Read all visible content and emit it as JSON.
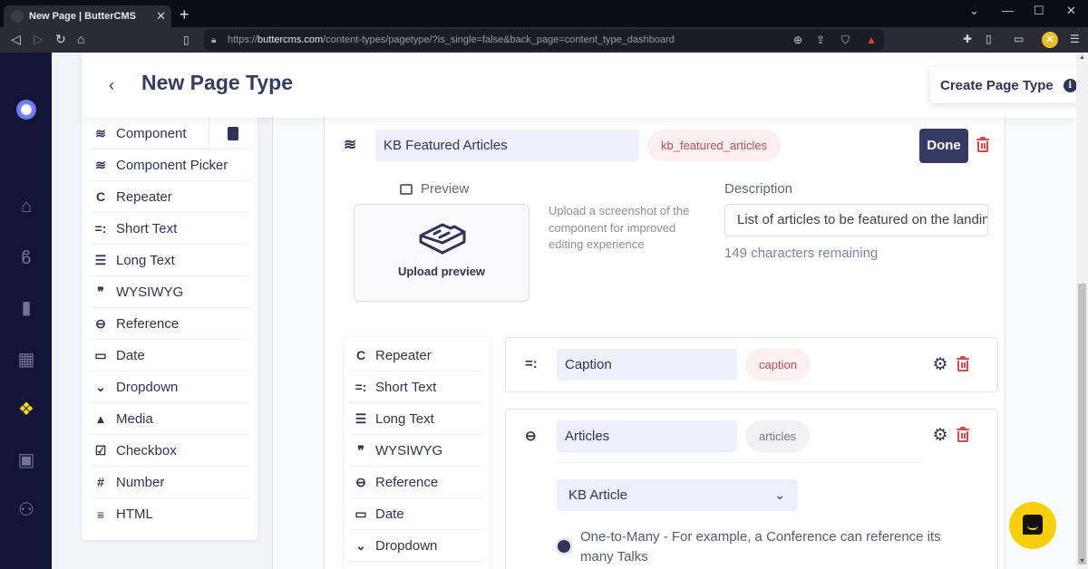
{
  "browser": {
    "tab_title": "New Page | ButterCMS",
    "tab_close": "✕",
    "new_tab": "+",
    "url_host": "buttercms.com",
    "url_scheme": "https://",
    "url_path": "/content-types/pagetype/?is_single=false&back_page=content_type_dashboard",
    "window_controls": [
      "⌄",
      "—",
      "☐",
      "✕"
    ],
    "nav_icons": [
      "back-icon",
      "forward-icon",
      "reload-icon",
      "home-icon"
    ],
    "profile_initial": "✕"
  },
  "app_nav": {
    "items": [
      {
        "icon": "home-icon",
        "glyph": "⌂"
      },
      {
        "icon": "blog-icon",
        "glyph": "ϐ"
      },
      {
        "icon": "page-icon",
        "glyph": "▮"
      },
      {
        "icon": "collections-icon",
        "glyph": "▦"
      },
      {
        "icon": "content-types-icon",
        "glyph": "❖",
        "active": true
      },
      {
        "icon": "media-icon",
        "glyph": "▣"
      },
      {
        "icon": "users-icon",
        "glyph": "⚇"
      }
    ]
  },
  "header": {
    "back_glyph": "‹",
    "title": "New Page Type",
    "create_button": "Create Page Type",
    "info_glyph": "i"
  },
  "palette": {
    "items": [
      {
        "label": "Component",
        "icon": "layers-icon",
        "glyph": "≋"
      },
      {
        "label": "Component Picker",
        "icon": "layers-plus-icon",
        "glyph": "≋"
      },
      {
        "label": "Repeater",
        "icon": "repeat-icon",
        "glyph": "C"
      },
      {
        "label": "Short Text",
        "icon": "short-text-icon",
        "glyph": "=:"
      },
      {
        "label": "Long Text",
        "icon": "long-text-icon",
        "glyph": "☰"
      },
      {
        "label": "WYSIWYG",
        "icon": "quote-icon",
        "glyph": "❞"
      },
      {
        "label": "Reference",
        "icon": "link-icon",
        "glyph": "⊖"
      },
      {
        "label": "Date",
        "icon": "calendar-icon",
        "glyph": "▭"
      },
      {
        "label": "Dropdown",
        "icon": "chevron-down-icon",
        "glyph": "⌄"
      },
      {
        "label": "Media",
        "icon": "image-icon",
        "glyph": "▴"
      },
      {
        "label": "Checkbox",
        "icon": "checkbox-icon",
        "glyph": "☑"
      },
      {
        "label": "Number",
        "icon": "hash-icon",
        "glyph": "#"
      },
      {
        "label": "HTML",
        "icon": "list-icon",
        "glyph": "≡"
      }
    ]
  },
  "component": {
    "name": "KB Featured Articles",
    "key": "kb_featured_articles",
    "done_button": "Done",
    "preview_label": "Preview",
    "upload_label": "Upload preview",
    "upload_hint": "Upload a screenshot of the component for improved editing experience",
    "description_label": "Description",
    "description_value": "List of articles to be featured on the landing page",
    "chars_remaining": "149 characters remaining"
  },
  "nested_palette": {
    "items": [
      {
        "label": "Repeater",
        "icon": "repeat-icon",
        "glyph": "C"
      },
      {
        "label": "Short Text",
        "icon": "short-text-icon",
        "glyph": "=:"
      },
      {
        "label": "Long Text",
        "icon": "long-text-icon",
        "glyph": "☰"
      },
      {
        "label": "WYSIWYG",
        "icon": "quote-icon",
        "glyph": "❞"
      },
      {
        "label": "Reference",
        "icon": "link-icon",
        "glyph": "⊖"
      },
      {
        "label": "Date",
        "icon": "calendar-icon",
        "glyph": "▭"
      },
      {
        "label": "Dropdown",
        "icon": "chevron-down-icon",
        "glyph": "⌄"
      }
    ]
  },
  "fields": [
    {
      "type": "Short Text",
      "icon": "short-text-icon",
      "glyph": "=:",
      "name": "Caption",
      "key": "caption",
      "key_style": "red"
    },
    {
      "type": "Reference",
      "icon": "link-icon",
      "glyph": "⊖",
      "name": "Articles",
      "key": "articles",
      "key_style": "grey",
      "reference_target": "KB Article",
      "relation_option": "One-to-Many - For example, a Conference can reference its many Talks"
    }
  ],
  "colors": {
    "nav_bg": "#111538",
    "primary": "#353b63",
    "danger": "#d44a4a",
    "active_nav": "#f5d81f",
    "chat": "#f7cf0d"
  }
}
